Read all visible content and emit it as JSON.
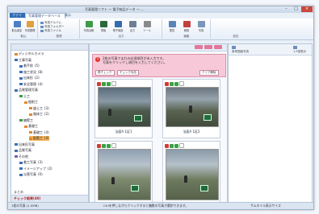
{
  "window": {
    "title": "写真管理ソフト ー 電子納品データ ー ..."
  },
  "tabs": {
    "file": "ファイル",
    "home": "写真管理データベース",
    "view": "表示"
  },
  "ribbon": {
    "buttons": [
      "取込設定",
      "写真整理",
      "写真台帳",
      "黒板",
      "電子納品",
      "出力",
      "ツール",
      "属性",
      "削除",
      "写真"
    ],
    "small_items": [
      "写真アルバム",
      "写真フォルダー",
      "写真ファイル"
    ],
    "groups": [
      "取込",
      "整理",
      "出力",
      "編集",
      "設定"
    ]
  },
  "sidebar": {
    "header": "",
    "items": [
      {
        "label": "ディジタルカメラ",
        "level": 1,
        "color": "orange"
      },
      {
        "label": "工事写真",
        "level": 1,
        "color": "blue"
      },
      {
        "label": "着手前",
        "level": 2,
        "color": "blue",
        "count": "(5)"
      },
      {
        "label": "施工状況",
        "level": 2,
        "color": "blue",
        "count": "(8)"
      },
      {
        "label": "出来形",
        "level": 2,
        "color": "blue",
        "count": "(2)"
      },
      {
        "label": "安全管理",
        "level": 2,
        "color": "blue",
        "count": "(4)"
      },
      {
        "label": "品質管理写真",
        "level": 1,
        "color": "blue"
      },
      {
        "label": "土工",
        "level": 2,
        "color": "green"
      },
      {
        "label": "掘削工",
        "level": 3,
        "color": "orange"
      },
      {
        "label": "盛土工",
        "level": 4,
        "color": "orange",
        "count": "(3)"
      },
      {
        "label": "路体工",
        "level": 4,
        "color": "orange",
        "count": "(2)"
      },
      {
        "label": "擁壁工",
        "level": 2,
        "color": "green"
      },
      {
        "label": "基礎工",
        "level": 3,
        "color": "orange"
      },
      {
        "label": "基礎工",
        "level": 4,
        "color": "orange",
        "count": "(4)"
      },
      {
        "label": "配筋工",
        "level": 4,
        "color": "orange",
        "count": "(4)"
      },
      {
        "label": "出来形写真",
        "level": 1,
        "color": "blue"
      },
      {
        "label": "品質写真",
        "level": 1,
        "color": "blue"
      },
      {
        "label": "その他",
        "level": 1,
        "color": "purple"
      },
      {
        "label": "着工写真",
        "level": 2,
        "color": "blue",
        "count": "(3)"
      },
      {
        "label": "イメージアップ",
        "level": 2,
        "color": "blue",
        "count": "(2)"
      },
      {
        "label": "災害写真",
        "level": 2,
        "color": "blue",
        "count": "(0)"
      }
    ],
    "footer_tag": "まとめ",
    "footer_check": "チェック結果",
    "footer_count": "(40)"
  },
  "content": {
    "notice": {
      "line1": "2枚の写真でまれの必須項目が未入力です。",
      "line2": "写真をクリックし項目を入力してください。",
      "buttons": [
        "再チェック",
        "チェック対応",
        "クリア解除"
      ]
    },
    "cards": [
      {
        "caption": "法面A 1区1"
      },
      {
        "caption": "法面A 1区2"
      },
      {
        "caption": ""
      },
      {
        "caption": ""
      }
    ]
  },
  "rightpanel": {
    "label": "参考図面写真",
    "zoom": "1,5倍表示"
  },
  "statusbar": {
    "left": "1枚の写真 (1.0MB)",
    "middle": "Ctrlを押しながらクリックすると複数の写真が選択できます。",
    "right": "サムネイル表示サイズ"
  },
  "colors": {
    "accent": "#2f6db5",
    "notice_bg": "#f7c9d8",
    "selected": "#f4b35b"
  }
}
